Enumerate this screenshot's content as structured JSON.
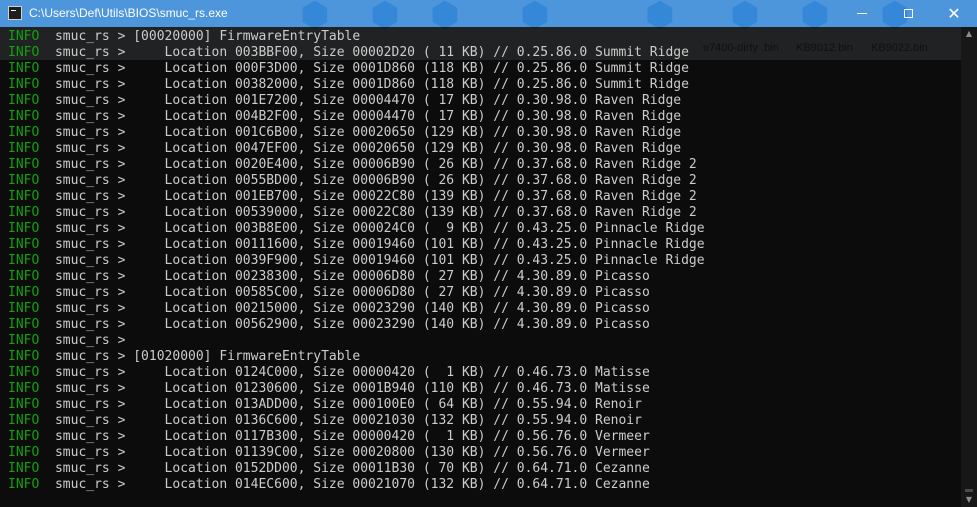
{
  "window": {
    "title": "C:\\Users\\Def\\Utils\\BIOS\\smuc_rs.exe",
    "minimize_glyph": "",
    "maximize_glyph": "",
    "close_glyph": "✕"
  },
  "desktop_labels": [
    "e7400-dirty\n.bin",
    "KB9012.bin",
    "KB9022.bin"
  ],
  "log_lines": [
    {
      "level": "INFO",
      "text": "  smuc_rs > [00020000] FirmwareEntryTable"
    },
    {
      "level": "INFO",
      "text": "  smuc_rs >     Location 003BBF00, Size 00002D20 ( 11 KB) // 0.25.86.0 Summit Ridge"
    },
    {
      "level": "INFO",
      "text": "  smuc_rs >     Location 000F3D00, Size 0001D860 (118 KB) // 0.25.86.0 Summit Ridge"
    },
    {
      "level": "INFO",
      "text": "  smuc_rs >     Location 00382000, Size 0001D860 (118 KB) // 0.25.86.0 Summit Ridge"
    },
    {
      "level": "INFO",
      "text": "  smuc_rs >     Location 001E7200, Size 00004470 ( 17 KB) // 0.30.98.0 Raven Ridge"
    },
    {
      "level": "INFO",
      "text": "  smuc_rs >     Location 004B2F00, Size 00004470 ( 17 KB) // 0.30.98.0 Raven Ridge"
    },
    {
      "level": "INFO",
      "text": "  smuc_rs >     Location 001C6B00, Size 00020650 (129 KB) // 0.30.98.0 Raven Ridge"
    },
    {
      "level": "INFO",
      "text": "  smuc_rs >     Location 0047EF00, Size 00020650 (129 KB) // 0.30.98.0 Raven Ridge"
    },
    {
      "level": "INFO",
      "text": "  smuc_rs >     Location 0020E400, Size 00006B90 ( 26 KB) // 0.37.68.0 Raven Ridge 2"
    },
    {
      "level": "INFO",
      "text": "  smuc_rs >     Location 0055BD00, Size 00006B90 ( 26 KB) // 0.37.68.0 Raven Ridge 2"
    },
    {
      "level": "INFO",
      "text": "  smuc_rs >     Location 001EB700, Size 00022C80 (139 KB) // 0.37.68.0 Raven Ridge 2"
    },
    {
      "level": "INFO",
      "text": "  smuc_rs >     Location 00539000, Size 00022C80 (139 KB) // 0.37.68.0 Raven Ridge 2"
    },
    {
      "level": "INFO",
      "text": "  smuc_rs >     Location 003B8E00, Size 000024C0 (  9 KB) // 0.43.25.0 Pinnacle Ridge"
    },
    {
      "level": "INFO",
      "text": "  smuc_rs >     Location 00111600, Size 00019460 (101 KB) // 0.43.25.0 Pinnacle Ridge"
    },
    {
      "level": "INFO",
      "text": "  smuc_rs >     Location 0039F900, Size 00019460 (101 KB) // 0.43.25.0 Pinnacle Ridge"
    },
    {
      "level": "INFO",
      "text": "  smuc_rs >     Location 00238300, Size 00006D80 ( 27 KB) // 4.30.89.0 Picasso"
    },
    {
      "level": "INFO",
      "text": "  smuc_rs >     Location 00585C00, Size 00006D80 ( 27 KB) // 4.30.89.0 Picasso"
    },
    {
      "level": "INFO",
      "text": "  smuc_rs >     Location 00215000, Size 00023290 (140 KB) // 4.30.89.0 Picasso"
    },
    {
      "level": "INFO",
      "text": "  smuc_rs >     Location 00562900, Size 00023290 (140 KB) // 4.30.89.0 Picasso"
    },
    {
      "level": "INFO",
      "text": "  smuc_rs >"
    },
    {
      "level": "INFO",
      "text": "  smuc_rs > [01020000] FirmwareEntryTable"
    },
    {
      "level": "INFO",
      "text": "  smuc_rs >     Location 0124C000, Size 00000420 (  1 KB) // 0.46.73.0 Matisse"
    },
    {
      "level": "INFO",
      "text": "  smuc_rs >     Location 01230600, Size 0001B940 (110 KB) // 0.46.73.0 Matisse"
    },
    {
      "level": "INFO",
      "text": "  smuc_rs >     Location 013ADD00, Size 000100E0 ( 64 KB) // 0.55.94.0 Renoir"
    },
    {
      "level": "INFO",
      "text": "  smuc_rs >     Location 0136C600, Size 00021030 (132 KB) // 0.55.94.0 Renoir"
    },
    {
      "level": "INFO",
      "text": "  smuc_rs >     Location 0117B300, Size 00000420 (  1 KB) // 0.56.76.0 Vermeer"
    },
    {
      "level": "INFO",
      "text": "  smuc_rs >     Location 01139C00, Size 00020800 (130 KB) // 0.56.76.0 Vermeer"
    },
    {
      "level": "INFO",
      "text": "  smuc_rs >     Location 0152DD00, Size 00011B30 ( 70 KB) // 0.64.71.0 Cezanne"
    },
    {
      "level": "INFO",
      "text": "  smuc_rs >     Location 014EC600, Size 00021070 (132 KB) // 0.64.71.0 Cezanne"
    }
  ],
  "colors": {
    "info_level": "#13a10e",
    "log_text": "#cccccc",
    "terminal_bg": "#0c0c0c",
    "titlebar": "#1876d2"
  },
  "icons": {
    "app": "console-icon",
    "minimize": "minimize-icon",
    "maximize": "maximize-icon",
    "close": "close-icon",
    "scroll_up": "arrow-up-icon",
    "scroll_down": "arrow-down-icon"
  }
}
